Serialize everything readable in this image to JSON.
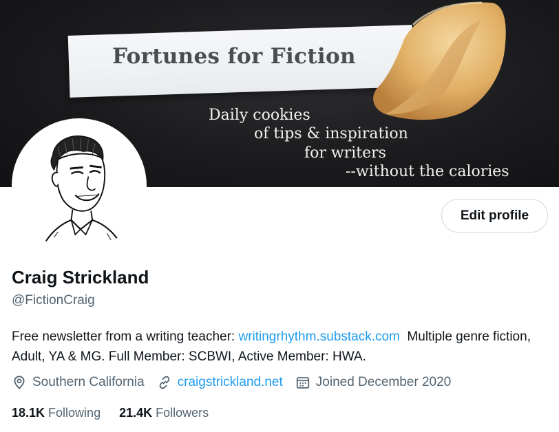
{
  "banner": {
    "paper_text": "Fortunes for Fiction",
    "tagline": [
      "Daily cookies",
      "of tips & inspiration",
      "for writers",
      "--without the calories"
    ]
  },
  "profile": {
    "edit_label": "Edit profile",
    "name": "Craig Strickland",
    "handle": "@FictionCraig",
    "bio_prefix": "Free newsletter from a writing teacher: ",
    "bio_link": "writingrhythm.substack.com",
    "bio_suffix": "  Multiple genre fiction, Adult, YA & MG. Full Member: SCBWI, Active Member: HWA.",
    "location": "Southern California",
    "website": "craigstrickland.net",
    "joined": "Joined December 2020",
    "following_count": "18.1K",
    "following_label": "Following",
    "followers_count": "21.4K",
    "followers_label": "Followers"
  },
  "colors": {
    "link": "#1d9bf0",
    "muted": "#536471",
    "text": "#0f1419"
  }
}
